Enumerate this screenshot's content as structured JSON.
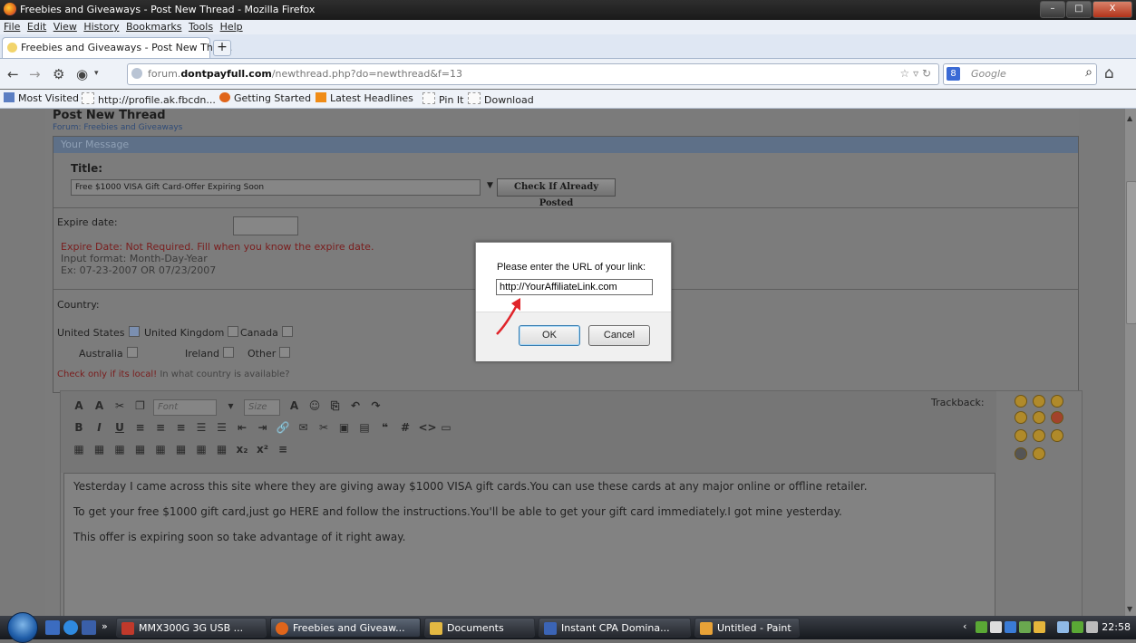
{
  "window": {
    "title": "Freebies and Giveaways - Post New Thread - Mozilla Firefox",
    "buttons": [
      "–",
      "□",
      "X"
    ]
  },
  "menu": [
    "File",
    "Edit",
    "View",
    "History",
    "Bookmarks",
    "Tools",
    "Help"
  ],
  "tab": {
    "label": "Freebies and Giveaways - Post New Thre...",
    "new_tab": "+"
  },
  "url": {
    "prefix": "forum.",
    "domain": "dontpayfull.com",
    "path": "/newthread.php?do=newthread&f=13"
  },
  "search": {
    "engine": "8",
    "placeholder": "Google"
  },
  "bookmarks": [
    "Most Visited",
    "http://profile.ak.fbcdn...",
    "Getting Started",
    "Latest Headlines",
    "Pin It",
    "Download"
  ],
  "page": {
    "title": "Post New Thread",
    "forum": "Forum: Freebies and Giveaways",
    "panel_header": "Your Message",
    "title_label": "Title:",
    "title_value": "Free $1000 VISA Gift Card-Offer Expiring Soon",
    "check_button": "Check If Already Posted",
    "expire_label": "Expire date:",
    "expire_note": "Expire Date: Not Required. Fill when you know the expire date.",
    "input_format": "Input format: Month-Day-Year",
    "example": "Ex: 07-23-2007 OR 07/23/2007",
    "country_label": "Country:",
    "countries": [
      {
        "name": "United States",
        "checked": true
      },
      {
        "name": "United Kingdom",
        "checked": false
      },
      {
        "name": "Canada",
        "checked": false
      },
      {
        "name": "Australia",
        "checked": false
      },
      {
        "name": "Ireland",
        "checked": false
      },
      {
        "name": "Other",
        "checked": false
      }
    ],
    "country_note_red": "Check only if its local!",
    "country_note": " In what country is available?"
  },
  "editor": {
    "font_select": "Font",
    "size_select": "Size",
    "trackback": "Trackback:",
    "lines": [
      "Yesterday I came across this site where they are giving away $1000 VISA gift cards.You can use these cards at any major online or offline retailer.",
      "To get your free $1000 gift card,just go HERE and follow the instructions.You'll be able to get your gift card immediately.I got mine yesterday.",
      "This offer is expiring soon so take advantage of it right away."
    ]
  },
  "dialog": {
    "prompt": "Please enter the URL of your link:",
    "value": "http://YourAffiliateLink.com",
    "ok": "OK",
    "cancel": "Cancel"
  },
  "taskbar": {
    "items": [
      "MMX300G 3G USB ...",
      "Freebies and Giveaw...",
      "Documents",
      "Instant CPA Domina...",
      "Untitled - Paint"
    ],
    "overflow": "»",
    "clock": "22:58"
  },
  "colors": {
    "accent_red": "#e0242a",
    "dialog_ok_border": "#3c7fb1"
  }
}
